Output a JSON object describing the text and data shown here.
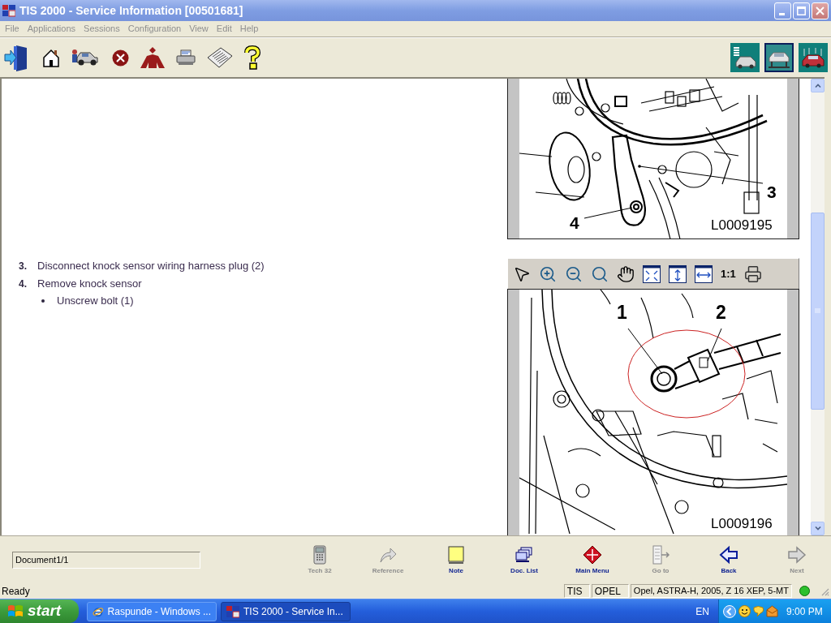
{
  "window": {
    "title": "TIS 2000 - Service Information [00501681]"
  },
  "menu": [
    {
      "label": "File",
      "disabled": true
    },
    {
      "label": "Applications",
      "disabled": true
    },
    {
      "label": "Sessions",
      "disabled": true
    },
    {
      "label": "Configuration",
      "disabled": true
    },
    {
      "label": "View",
      "disabled": true
    },
    {
      "label": "Edit",
      "disabled": true
    },
    {
      "label": "Help",
      "disabled": true
    }
  ],
  "mode_tiles": [
    {
      "selected": false
    },
    {
      "selected": true
    },
    {
      "selected": false
    }
  ],
  "steps": [
    {
      "number": "3.",
      "text": "Disconnect knock sensor wiring harness plug (2)"
    },
    {
      "number": "4.",
      "text": "Remove knock sensor",
      "children": [
        {
          "text": "Unscrew bolt (1)"
        }
      ]
    }
  ],
  "figures": [
    {
      "kind": "bracket",
      "callouts": [
        "3",
        "4"
      ],
      "code": "L0009195"
    },
    {
      "kind": "knock_sensor",
      "callouts": [
        "1",
        "2"
      ],
      "code": "L0009196"
    }
  ],
  "image_toolbar": {
    "actual_size": "1:1"
  },
  "document_field": {
    "value": "Document1/1"
  },
  "nav_buttons": [
    {
      "label": "Tech 32",
      "disabled": true
    },
    {
      "label": "Reference",
      "disabled": true
    },
    {
      "label": "Note",
      "disabled": false
    },
    {
      "label": "Doc. List",
      "disabled": false
    },
    {
      "label": "Main Menu",
      "disabled": false
    },
    {
      "label": "Go to",
      "disabled": true
    },
    {
      "label": "Back",
      "disabled": false
    },
    {
      "label": "Next",
      "disabled": true
    }
  ],
  "status_bar": {
    "text": "Ready",
    "panels": [
      "TIS",
      "OPEL",
      "Opel, ASTRA-H, 2005, Z 16 XEP, 5-MT"
    ]
  },
  "taskbar": {
    "start": "start",
    "tasks": [
      {
        "label": "Raspunde - Windows ...",
        "selected": false
      },
      {
        "label": "TIS 2000 - Service In...",
        "selected": true
      }
    ],
    "language": "EN",
    "clock": "9:00 PM"
  }
}
